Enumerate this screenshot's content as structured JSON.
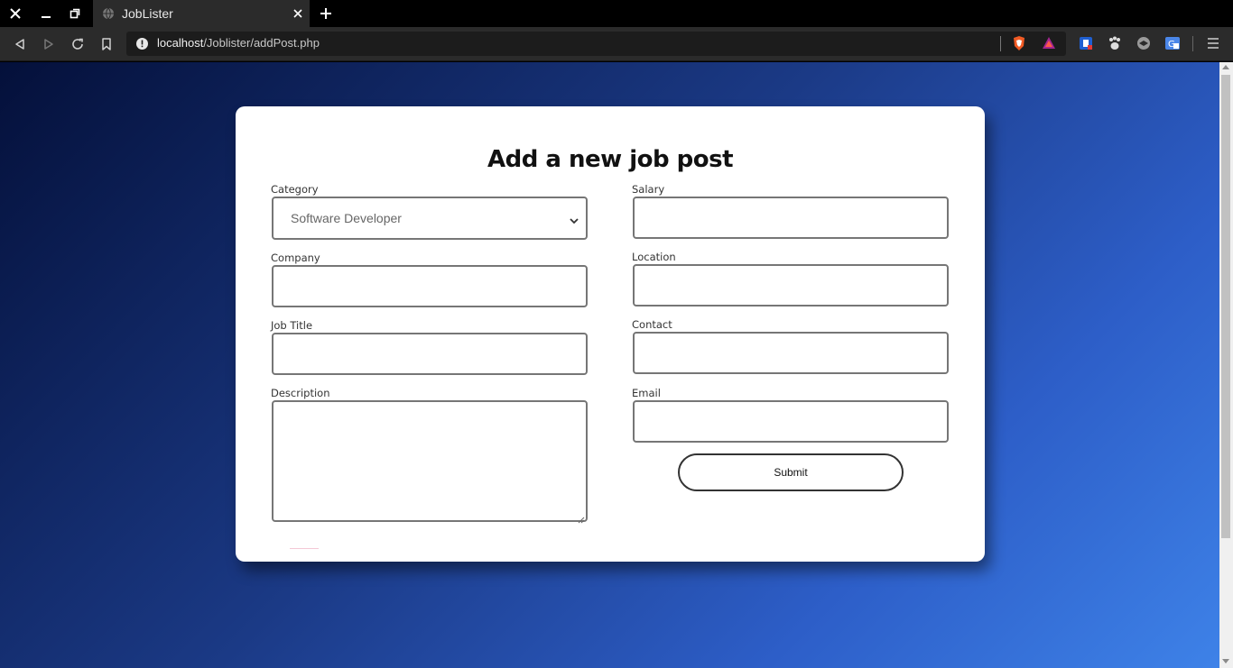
{
  "browser": {
    "tab_title": "JobLister",
    "url_host": "localhost",
    "url_path": "/Joblister/addPost.php"
  },
  "form": {
    "heading": "Add a new job post",
    "category_label": "Category",
    "category_value": "Software Developer",
    "company_label": "Company",
    "job_title_label": "Job Title",
    "description_label": "Description",
    "salary_label": "Salary",
    "location_label": "Location",
    "contact_label": "Contact",
    "email_label": "Email",
    "submit_label": "Submit"
  },
  "colors": {
    "background_start": "#04103a",
    "background_end": "#3e82e8",
    "card": "#ffffff",
    "brave_orange": "#f05a24"
  }
}
